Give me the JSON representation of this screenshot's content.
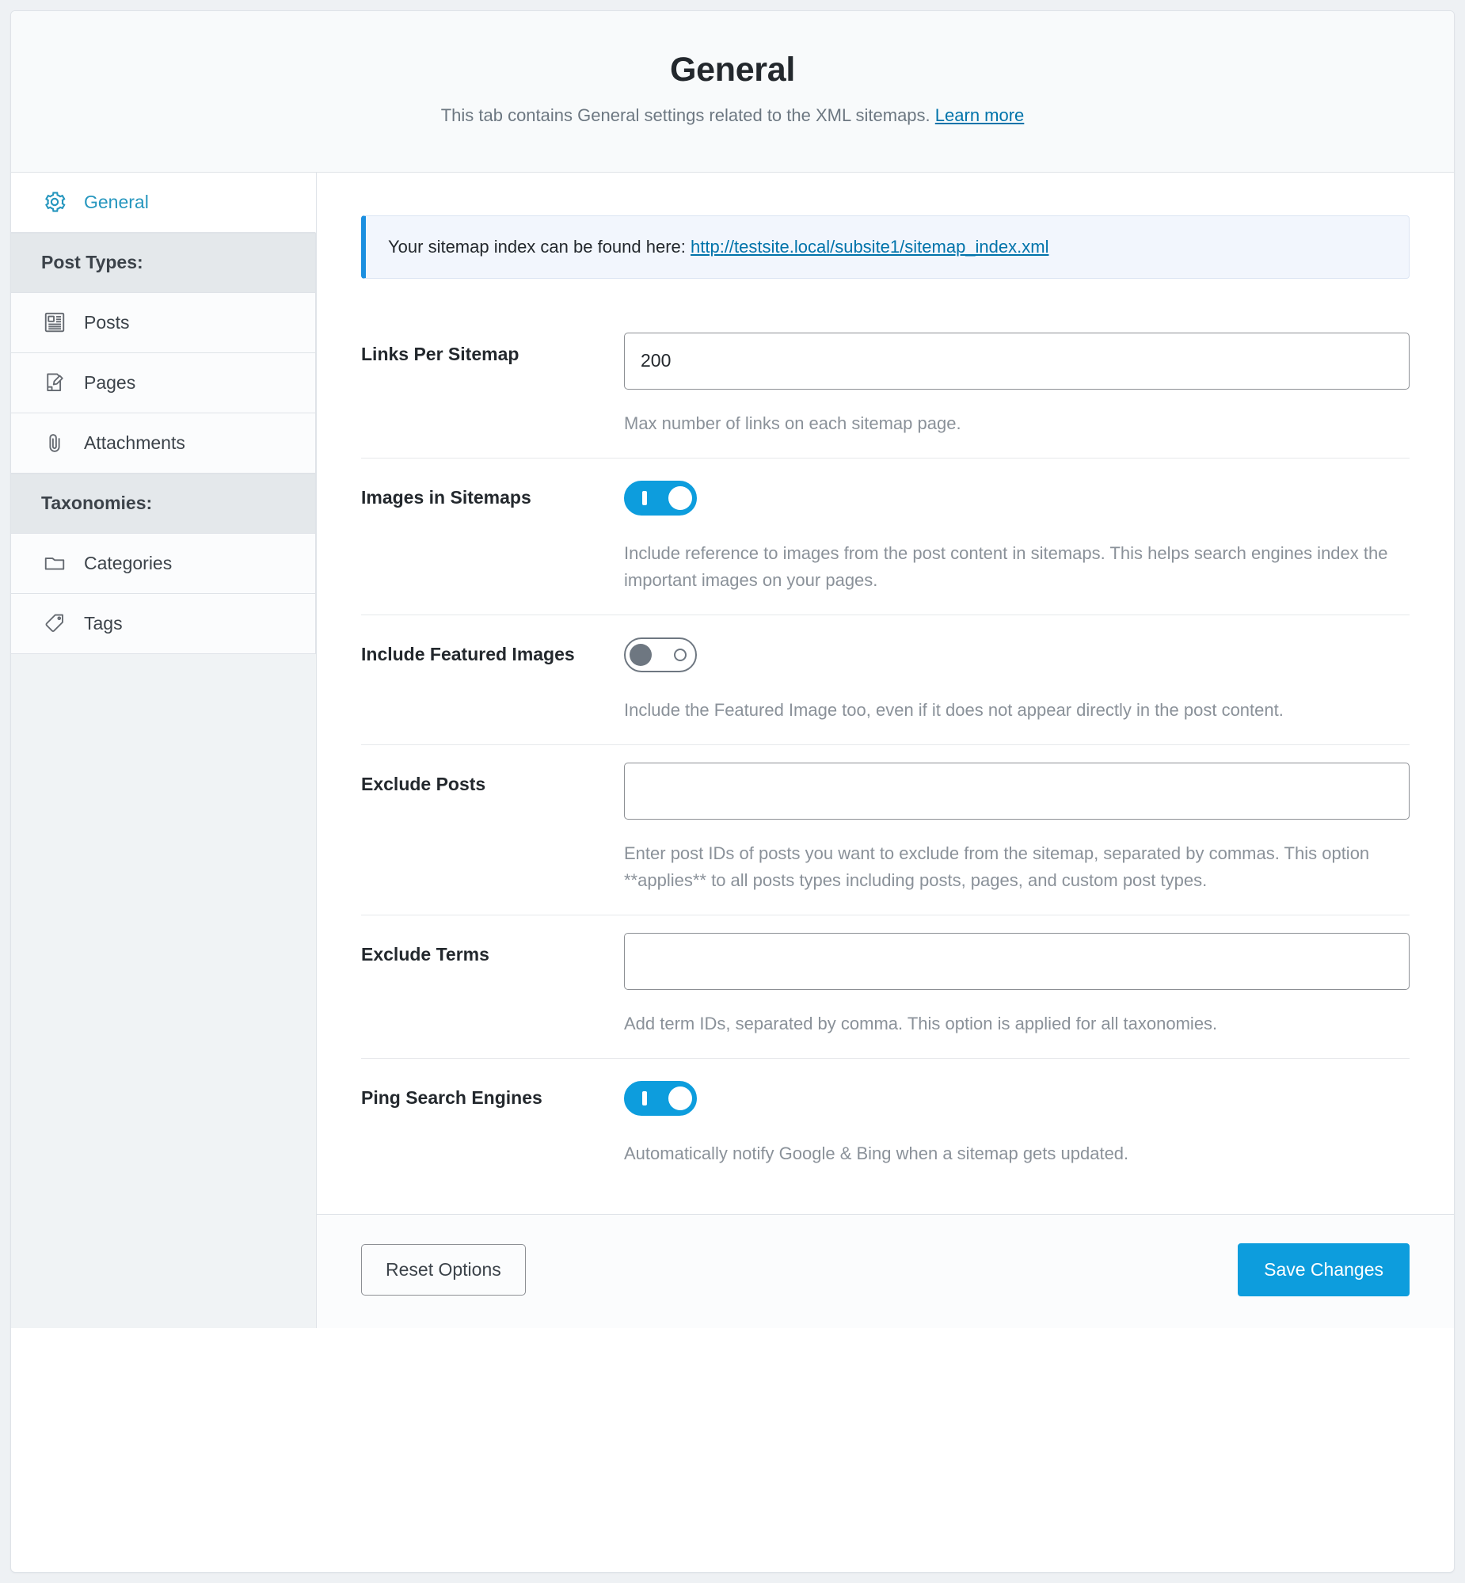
{
  "header": {
    "title": "General",
    "subtitle_text": "This tab contains General settings related to the XML sitemaps.",
    "learn_more_label": "Learn more"
  },
  "sidebar": {
    "items": [
      {
        "label": "General",
        "icon": "gear-icon",
        "active": true
      },
      {
        "label": "Post Types:",
        "type": "heading"
      },
      {
        "label": "Posts",
        "icon": "posts-icon"
      },
      {
        "label": "Pages",
        "icon": "page-edit-icon"
      },
      {
        "label": "Attachments",
        "icon": "paperclip-icon"
      },
      {
        "label": "Taxonomies:",
        "type": "heading"
      },
      {
        "label": "Categories",
        "icon": "folder-icon"
      },
      {
        "label": "Tags",
        "icon": "tag-icon"
      }
    ]
  },
  "notice": {
    "text": "Your sitemap index can be found here:",
    "link_label": "http://testsite.local/subsite1/sitemap_index.xml"
  },
  "settings": [
    {
      "label": "Links Per Sitemap",
      "control": "text",
      "value": "200",
      "placeholder": "",
      "help": "Max number of links on each sitemap page."
    },
    {
      "label": "Images in Sitemaps",
      "control": "toggle",
      "state": "on",
      "help": "Include reference to images from the post content in sitemaps. This helps search engines index the important images on your pages."
    },
    {
      "label": "Include Featured Images",
      "control": "toggle",
      "state": "off",
      "help": "Include the Featured Image too, even if it does not appear directly in the post content."
    },
    {
      "label": "Exclude Posts",
      "control": "text",
      "value": "",
      "placeholder": "",
      "help": "Enter post IDs of posts you want to exclude from the sitemap, separated by commas. This option **applies** to all posts types including posts, pages, and custom post types."
    },
    {
      "label": "Exclude Terms",
      "control": "text",
      "value": "",
      "placeholder": "",
      "help": "Add term IDs, separated by comma. This option is applied for all taxonomies."
    },
    {
      "label": "Ping Search Engines",
      "control": "toggle",
      "state": "on",
      "help": "Automatically notify Google & Bing when a sitemap gets updated."
    }
  ],
  "footer": {
    "reset_label": "Reset Options",
    "save_label": "Save Changes"
  },
  "colors": {
    "accent_blue": "#0d9ddd",
    "link_blue": "#0073aa",
    "active_tab_text": "#2596be",
    "notice_bg": "#f2f6fd",
    "notice_bar": "#1b8fe0"
  }
}
